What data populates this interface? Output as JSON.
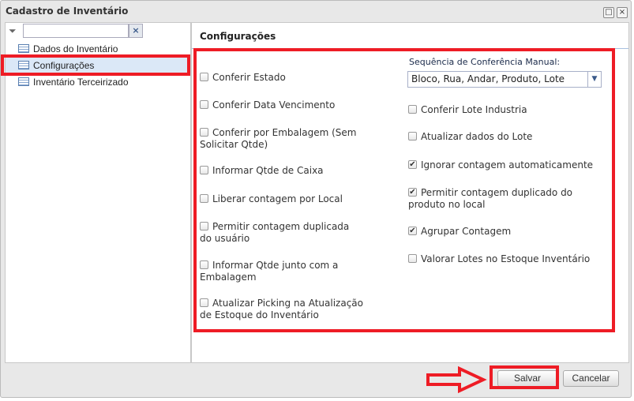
{
  "window": {
    "title": "Cadastro de Inventário",
    "maximize": "□",
    "close": "×"
  },
  "sidebar": {
    "filter_placeholder": "",
    "clear": "×",
    "items": [
      {
        "label": "Dados do Inventário"
      },
      {
        "label": "Configurações"
      },
      {
        "label": "Inventário Terceirizado"
      }
    ]
  },
  "main": {
    "heading": "Configurações",
    "left_checks": [
      {
        "label": "Conferir Estado",
        "checked": false
      },
      {
        "label": "Conferir Data Vencimento",
        "checked": false
      },
      {
        "label": "Conferir por Embalagem (Sem Solicitar Qtde)",
        "checked": false
      },
      {
        "label": "Informar Qtde de Caixa",
        "checked": false
      },
      {
        "label": "Liberar contagem por Local",
        "checked": false
      },
      {
        "label": "Permitir contagem duplicada do usuário",
        "checked": false
      },
      {
        "label": "Informar Qtde junto com a Embalagem",
        "checked": false
      },
      {
        "label": "Atualizar Picking na Atualização de Estoque do Inventário",
        "checked": false
      }
    ],
    "sequence_label": "Sequência de Conferência Manual:",
    "sequence_value": "Bloco, Rua, Andar, Produto, Lote",
    "right_checks": [
      {
        "label": "Conferir Lote Industria",
        "checked": false
      },
      {
        "label": "Atualizar dados do Lote",
        "checked": false
      },
      {
        "label": "Ignorar contagem automaticamente",
        "checked": true
      },
      {
        "label": "Permitir contagem duplicado do produto no local",
        "checked": true
      },
      {
        "label": "Agrupar Contagem",
        "checked": true
      },
      {
        "label": "Valorar Lotes no Estoque Inventário",
        "checked": false
      }
    ]
  },
  "footer": {
    "save": "Salvar",
    "cancel": "Cancelar"
  },
  "colors": {
    "highlight": "#ee1c25",
    "selected": "#dbe8f7"
  }
}
